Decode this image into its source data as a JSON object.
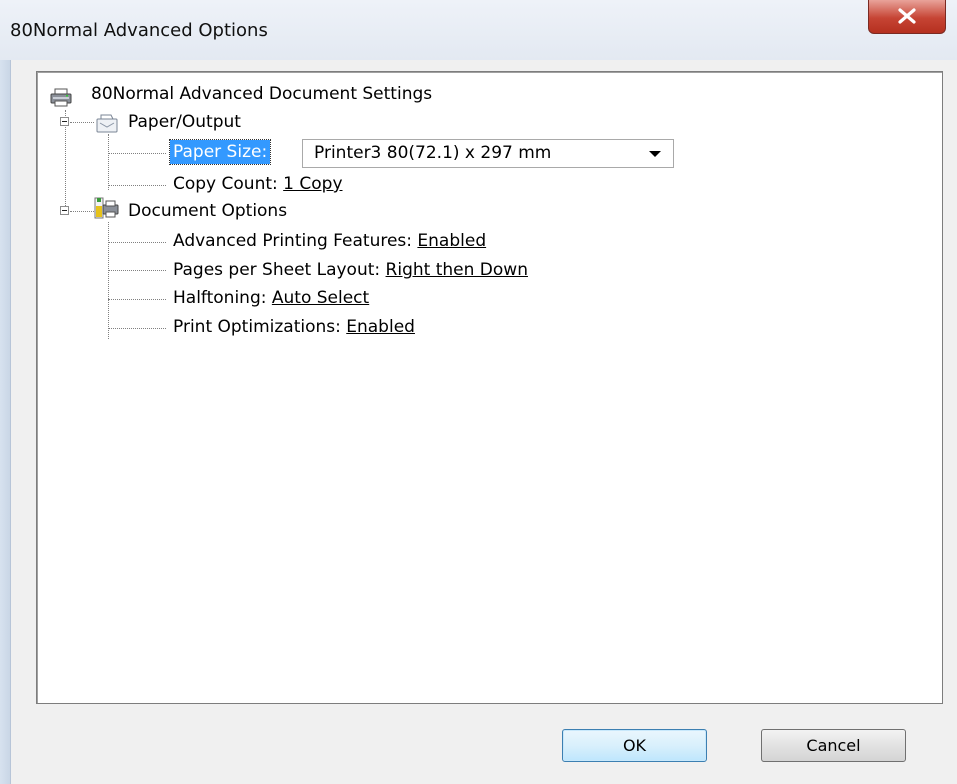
{
  "window": {
    "title": "80Normal Advanced Options",
    "close_glyph": "X"
  },
  "tree": {
    "root_label": "80Normal Advanced Document Settings",
    "paper_output": {
      "label": "Paper/Output",
      "paper_size": {
        "label": "Paper Size:",
        "value": "Printer3 80(72.1) x 297 mm"
      },
      "copy_count": {
        "label": "Copy Count:",
        "value": "1 Copy"
      }
    },
    "document_options": {
      "label": "Document Options",
      "items": [
        {
          "label": "Advanced Printing Features:",
          "value": "Enabled"
        },
        {
          "label": "Pages per Sheet Layout:",
          "value": "Right then Down"
        },
        {
          "label": "Halftoning:",
          "value": "Auto Select"
        },
        {
          "label": "Print Optimizations:",
          "value": "Enabled"
        }
      ]
    }
  },
  "buttons": {
    "ok": "OK",
    "cancel": "Cancel"
  },
  "icons": {
    "root": "printer-icon",
    "paper_output": "paper-output-icon",
    "document_options": "document-options-icon"
  },
  "colors": {
    "selection": "#3399ff",
    "close_button": "#c64434",
    "ok_border": "#3c7fb1"
  }
}
